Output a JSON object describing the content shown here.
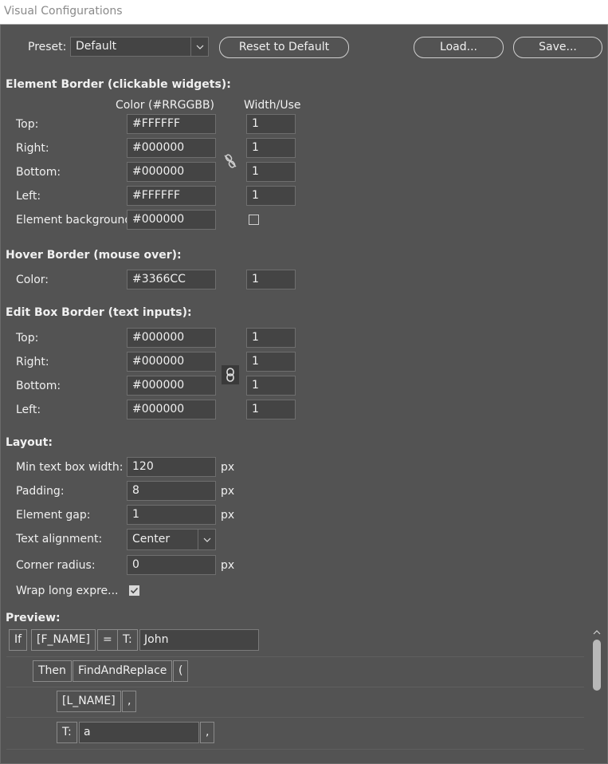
{
  "window": {
    "title": "Visual Configurations"
  },
  "toolbar": {
    "preset_label": "Preset:",
    "preset_value": "Default",
    "reset_label": "Reset to Default",
    "load_label": "Load...",
    "save_label": "Save..."
  },
  "element_border": {
    "heading": "Element Border (clickable widgets):",
    "col_color": "Color (#RRGGBB)",
    "col_width": "Width/Use",
    "rows": [
      {
        "label": "Top:",
        "color": "#FFFFFF",
        "width": "1"
      },
      {
        "label": "Right:",
        "color": "#000000",
        "width": "1"
      },
      {
        "label": "Bottom:",
        "color": "#000000",
        "width": "1"
      },
      {
        "label": "Left:",
        "color": "#FFFFFF",
        "width": "1"
      }
    ],
    "background_label": "Element background",
    "background_color": "#000000",
    "background_use": false,
    "link_icon": "unlinked-chain-icon"
  },
  "hover_border": {
    "heading": "Hover Border (mouse over):",
    "label": "Color:",
    "color": "#3366CC",
    "width": "1"
  },
  "edit_box_border": {
    "heading": "Edit Box Border (text inputs):",
    "rows": [
      {
        "label": "Top:",
        "color": "#000000",
        "width": "1"
      },
      {
        "label": "Right:",
        "color": "#000000",
        "width": "1"
      },
      {
        "label": "Bottom:",
        "color": "#000000",
        "width": "1"
      },
      {
        "label": "Left:",
        "color": "#000000",
        "width": "1"
      }
    ],
    "link_icon": "linked-chain-icon"
  },
  "layout": {
    "heading": "Layout:",
    "min_width_label": "Min text box width:",
    "min_width_value": "120",
    "padding_label": "Padding:",
    "padding_value": "8",
    "gap_label": "Element gap:",
    "gap_value": "1",
    "align_label": "Text alignment:",
    "align_value": "Center",
    "radius_label": "Corner radius:",
    "radius_value": "0",
    "wrap_label": "Wrap long expre...",
    "wrap_checked": true,
    "unit": "px"
  },
  "preview": {
    "heading": "Preview:",
    "row1": {
      "if": "If",
      "field": "[F_NAME]",
      "op": "=",
      "type": "T:",
      "value": "John"
    },
    "row2": {
      "then": "Then",
      "func": "FindAndReplace",
      "paren": "("
    },
    "row3": {
      "field": "[L_NAME]",
      "comma": ","
    },
    "row4": {
      "type": "T:",
      "value": "a",
      "comma": ","
    }
  },
  "colors": {
    "background": "#535353",
    "field": "#444444",
    "title_text": "#8a8a8a"
  }
}
